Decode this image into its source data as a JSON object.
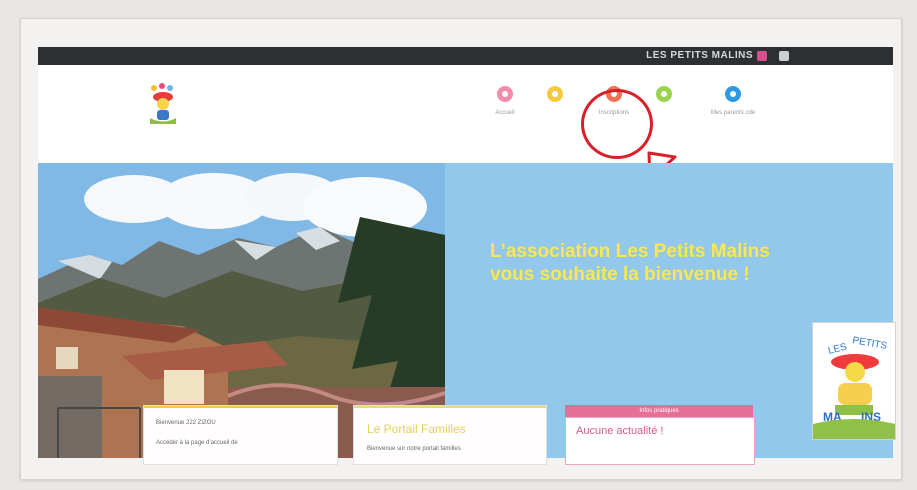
{
  "topbar": {
    "site_name": "LES PETITS MALINS"
  },
  "nav": {
    "items": [
      {
        "label": "Accueil"
      },
      {
        "label": ""
      },
      {
        "label": "Inscriptions"
      },
      {
        "label": ""
      },
      {
        "label": "Mes parents cde"
      }
    ]
  },
  "hero": {
    "title_line_1": "L’association Les Petits Malins",
    "title_line_2": "vous souhaite la bienvenue !"
  },
  "cards": {
    "welcome": {
      "heading": "Bienvenue 222 ZIZOU",
      "body": "Accéder à la page d’accueil de"
    },
    "portal": {
      "title": "Le Portail Familles",
      "body": "Bienvenue sur notre portail familles"
    },
    "practical": {
      "header": "Infos pratiques",
      "message": "Aucune actualité !"
    }
  },
  "colors": {
    "topbar": "#2d3033",
    "hero_blue": "#92c8ec",
    "hero_title": "#f6e85a",
    "highlight": "#d8202b",
    "nav_pink": "#f28ca8",
    "nav_yellow": "#f6ca3e",
    "nav_coral": "#f07155",
    "nav_lime": "#9bd24e",
    "nav_blue": "#2d99e5"
  },
  "icons": {
    "topbar": [
      "facebook-icon",
      "user-icon"
    ],
    "nav": [
      "pink-circle-icon",
      "yellow-circle-icon",
      "coral-circle-icon",
      "lime-circle-icon",
      "blue-circle-icon"
    ]
  }
}
